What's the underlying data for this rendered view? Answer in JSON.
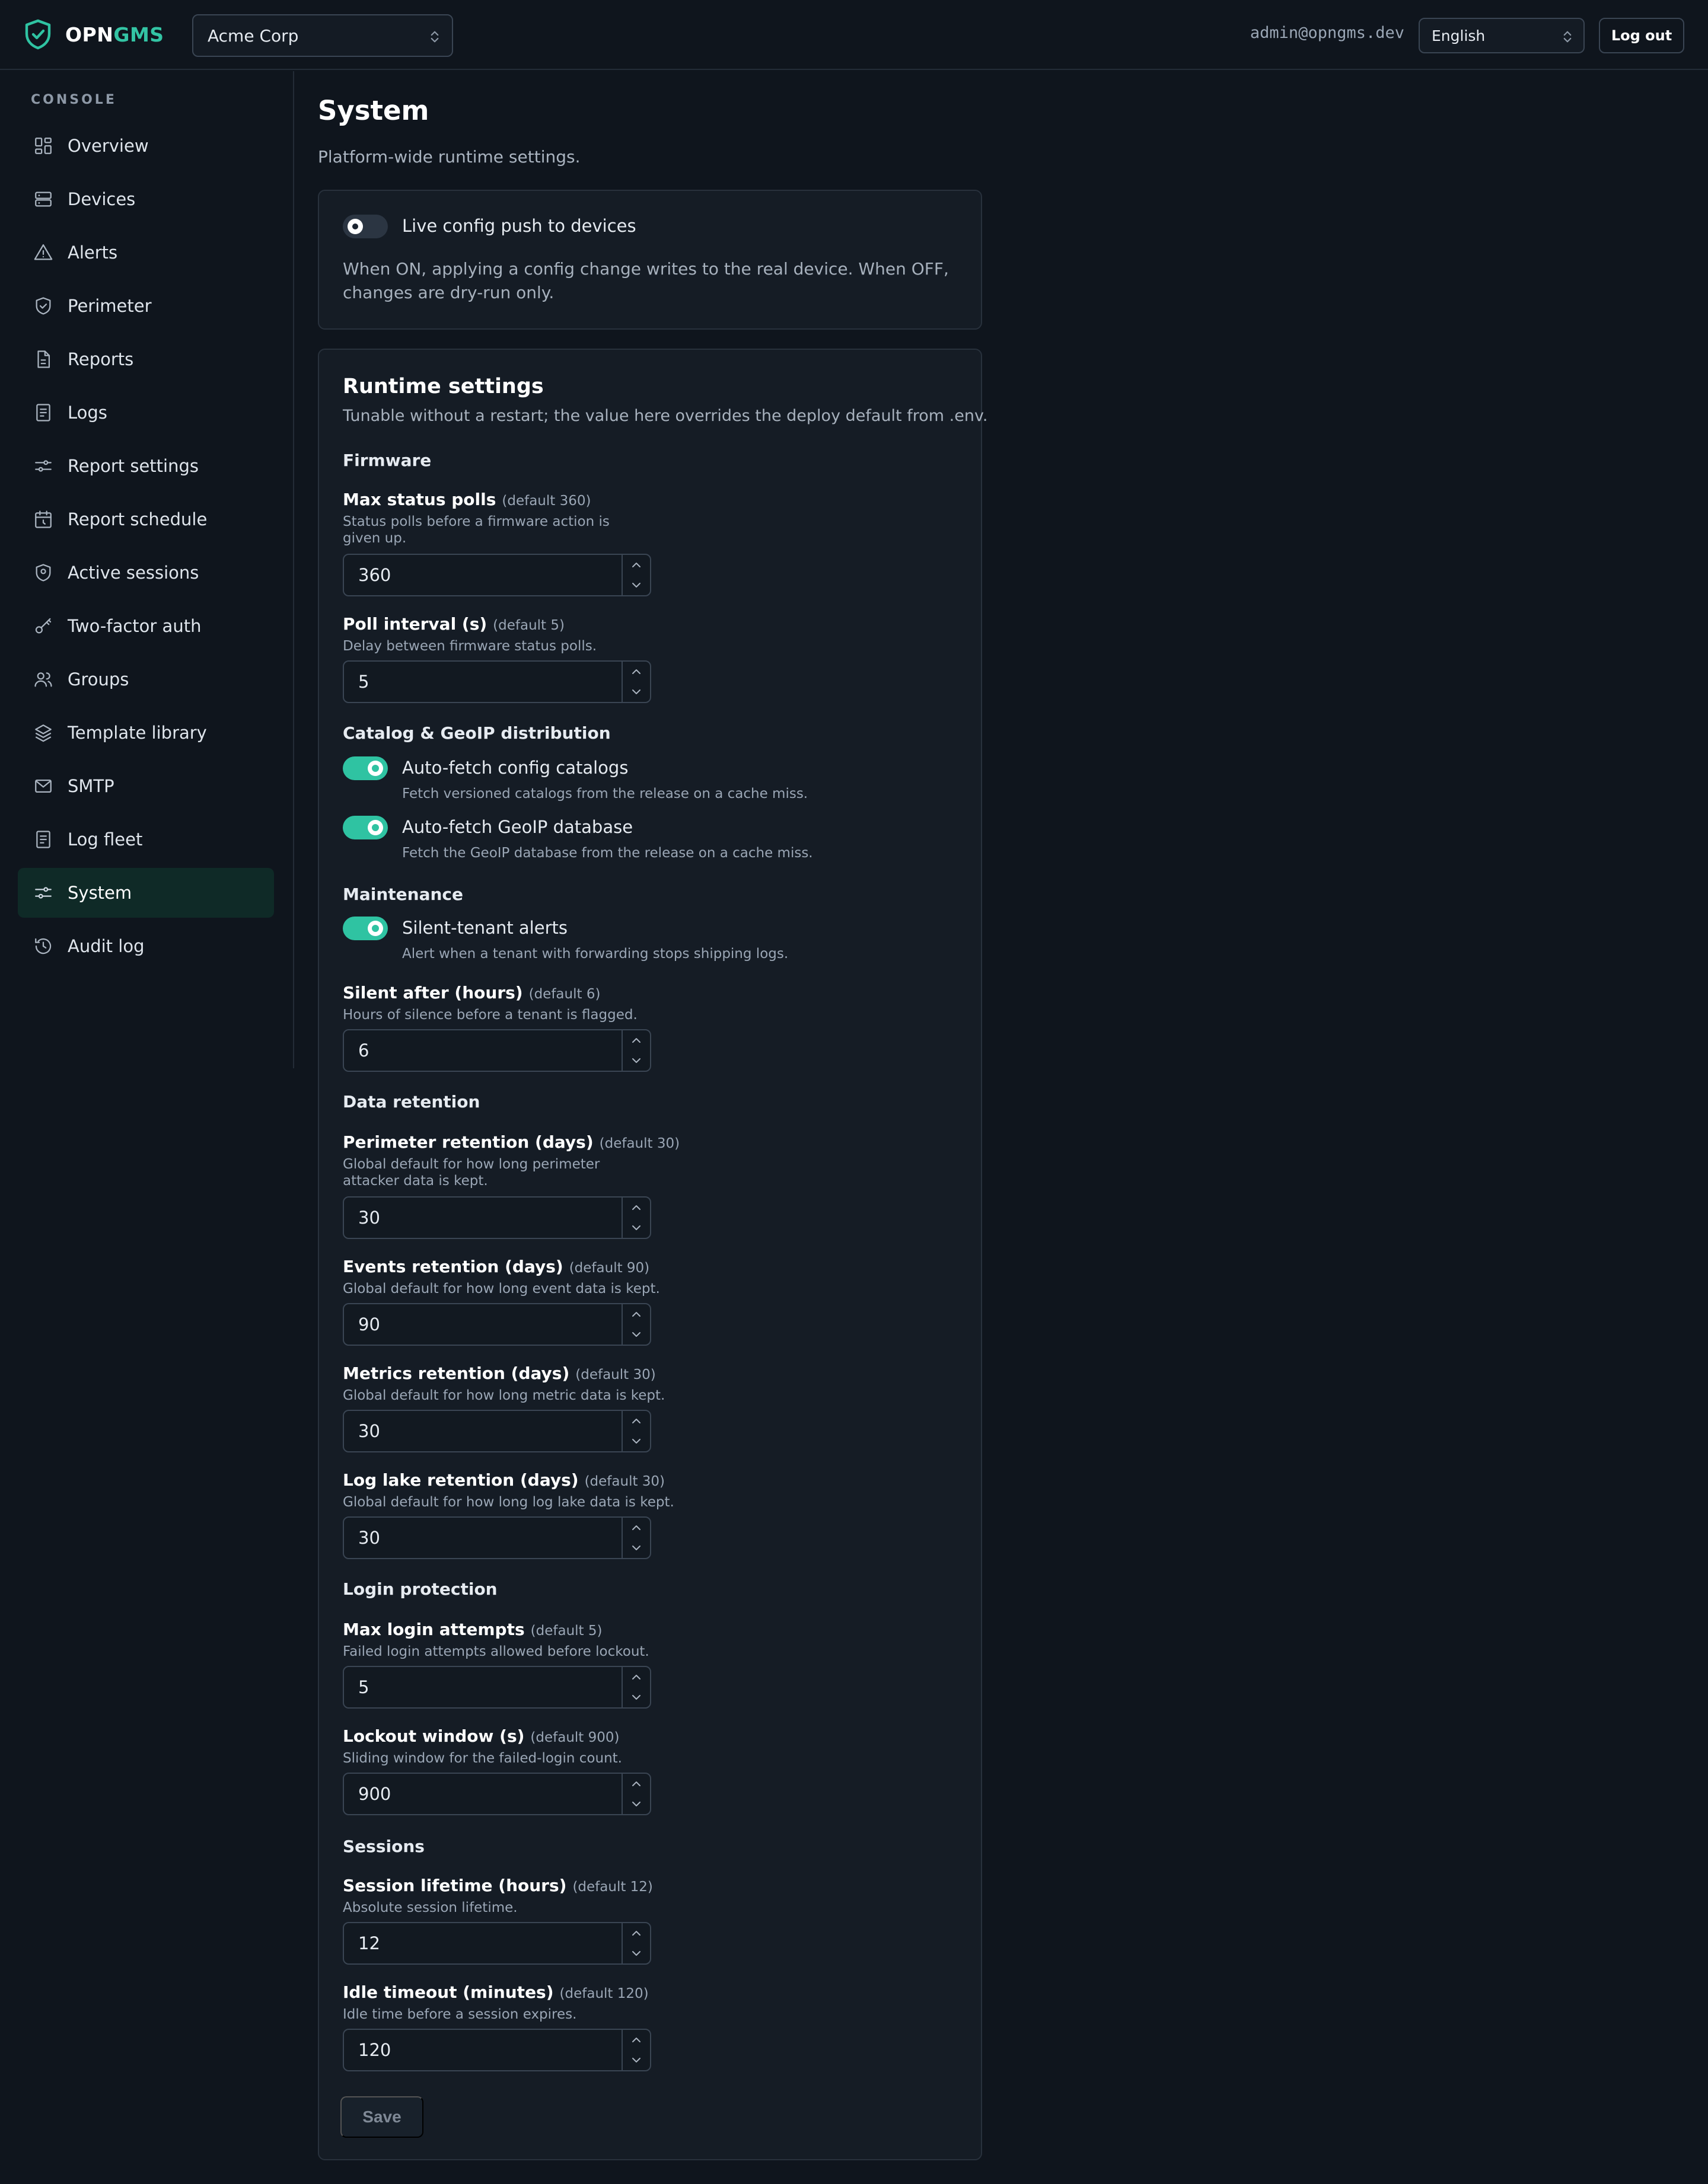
{
  "brand": {
    "part1": "OPN",
    "part2": "GMS"
  },
  "header": {
    "tenant": "Acme Corp",
    "user_email": "admin@opngms.dev",
    "language": "English",
    "logout_label": "Log out"
  },
  "sidebar": {
    "section_label": "CONSOLE",
    "items": [
      {
        "label": "Overview",
        "icon": "grid-icon"
      },
      {
        "label": "Devices",
        "icon": "server-icon"
      },
      {
        "label": "Alerts",
        "icon": "alert-triangle-icon"
      },
      {
        "label": "Perimeter",
        "icon": "shield-check-icon"
      },
      {
        "label": "Reports",
        "icon": "document-icon"
      },
      {
        "label": "Logs",
        "icon": "log-list-icon"
      },
      {
        "label": "Report settings",
        "icon": "sliders-icon"
      },
      {
        "label": "Report schedule",
        "icon": "calendar-clock-icon"
      },
      {
        "label": "Active sessions",
        "icon": "shield-user-icon"
      },
      {
        "label": "Two-factor auth",
        "icon": "key-icon"
      },
      {
        "label": "Groups",
        "icon": "users-icon"
      },
      {
        "label": "Template library",
        "icon": "layers-icon"
      },
      {
        "label": "SMTP",
        "icon": "mail-icon"
      },
      {
        "label": "Log fleet",
        "icon": "log-list-icon"
      },
      {
        "label": "System",
        "icon": "sliders-icon",
        "active": true
      },
      {
        "label": "Audit log",
        "icon": "history-icon"
      }
    ]
  },
  "page": {
    "title": "System",
    "subtitle": "Platform-wide runtime settings."
  },
  "live_push": {
    "label": "Live config push to devices",
    "enabled": false,
    "description": "When ON, applying a config change writes to the real device. When OFF, changes are dry-run only."
  },
  "runtime": {
    "title": "Runtime settings",
    "subtitle": "Tunable without a restart; the value here overrides the deploy default from .env.",
    "groups": {
      "firmware": "Firmware",
      "catalog": "Catalog & GeoIP distribution",
      "maintenance": "Maintenance",
      "retention": "Data retention",
      "login": "Login protection",
      "sessions": "Sessions"
    },
    "fields": {
      "max_status_polls": {
        "label": "Max status polls",
        "default": "(default 360)",
        "help": "Status polls before a firmware action is given up.",
        "value": "360"
      },
      "poll_interval": {
        "label": "Poll interval (s)",
        "default": "(default 5)",
        "help": "Delay between firmware status polls.",
        "value": "5"
      },
      "silent_after": {
        "label": "Silent after (hours)",
        "default": "(default 6)",
        "help": "Hours of silence before a tenant is flagged.",
        "value": "6"
      },
      "perimeter_retention": {
        "label": "Perimeter retention (days)",
        "default": "(default 30)",
        "help": "Global default for how long perimeter attacker data is kept.",
        "value": "30"
      },
      "events_retention": {
        "label": "Events retention (days)",
        "default": "(default 90)",
        "help": "Global default for how long event data is kept.",
        "value": "90"
      },
      "metrics_retention": {
        "label": "Metrics retention (days)",
        "default": "(default 30)",
        "help": "Global default for how long metric data is kept.",
        "value": "30"
      },
      "loglake_retention": {
        "label": "Log lake retention (days)",
        "default": "(default 30)",
        "help": "Global default for how long log lake data is kept.",
        "value": "30"
      },
      "max_login_attempts": {
        "label": "Max login attempts",
        "default": "(default 5)",
        "help": "Failed login attempts allowed before lockout.",
        "value": "5"
      },
      "lockout_window": {
        "label": "Lockout window (s)",
        "default": "(default 900)",
        "help": "Sliding window for the failed-login count.",
        "value": "900"
      },
      "session_lifetime": {
        "label": "Session lifetime (hours)",
        "default": "(default 12)",
        "help": "Absolute session lifetime.",
        "value": "12"
      },
      "idle_timeout": {
        "label": "Idle timeout (minutes)",
        "default": "(default 120)",
        "help": "Idle time before a session expires.",
        "value": "120"
      }
    },
    "toggles": {
      "auto_catalogs": {
        "label": "Auto-fetch config catalogs",
        "desc": "Fetch versioned catalogs from the release on a cache miss.",
        "enabled": true
      },
      "auto_geoip": {
        "label": "Auto-fetch GeoIP database",
        "desc": "Fetch the GeoIP database from the release on a cache miss.",
        "enabled": true
      },
      "silent_alerts": {
        "label": "Silent-tenant alerts",
        "desc": "Alert when a tenant with forwarding stops shipping logs.",
        "enabled": true
      }
    },
    "save_label": "Save"
  },
  "colors": {
    "accent": "#2fc3a2",
    "background": "#0f151d",
    "card": "#151c25"
  }
}
